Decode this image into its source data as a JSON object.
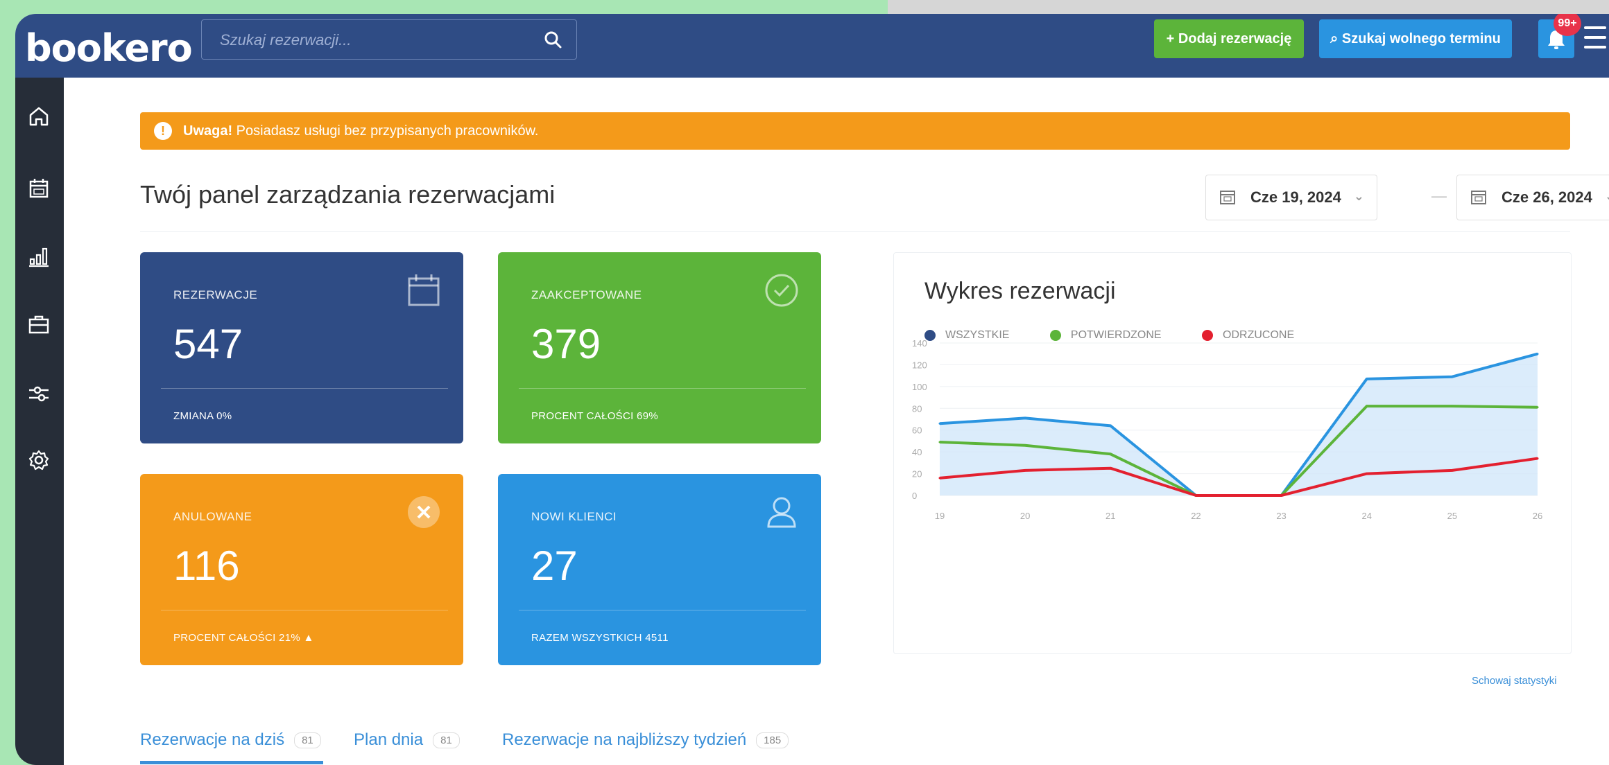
{
  "header": {
    "logo": "bookero",
    "search_placeholder": "Szukaj rezerwacji...",
    "add_button": "+ Dodaj rezerwację",
    "free_slot_button": "⌕ Szukaj wolnego terminu",
    "notifications_badge": "99+"
  },
  "sidebar": {
    "items": [
      "home-icon",
      "calendar-icon",
      "stats-icon",
      "briefcase-icon",
      "sliders-icon",
      "gear-icon"
    ]
  },
  "alert": {
    "bold": "Uwaga!",
    "text": " Posiadasz usługi bez przypisanych pracowników."
  },
  "page_title": "Twój panel zarządzania rezerwacjami",
  "date_range": {
    "from": "Cze 19, 2024",
    "to": "Cze 26, 2024",
    "separator": "—"
  },
  "cards": {
    "reservations": {
      "title": "REZERWACJE",
      "value": "547",
      "footer": "ZMIANA  0%",
      "color": "#2f4c85"
    },
    "accepted": {
      "title": "ZAAKCEPTOWANE",
      "value": "379",
      "footer": "PROCENT CAŁOŚCI  69%",
      "color": "#5cb43a"
    },
    "cancelled": {
      "title": "ANULOWANE",
      "value": "116",
      "footer": "PROCENT CAŁOŚCI  21%  ▲",
      "color": "#f49a1a"
    },
    "new_clients": {
      "title": "NOWI KLIENCI",
      "value": "27",
      "footer": "RAZEM WSZYSTKICH  4511",
      "color": "#2a94e0"
    }
  },
  "chart_data": {
    "type": "line",
    "title": "Wykres rezerwacji",
    "categories": [
      "19",
      "20",
      "21",
      "22",
      "23",
      "24",
      "25",
      "26"
    ],
    "ylim": [
      0,
      140
    ],
    "yticks": [
      "0",
      "20",
      "40",
      "60",
      "80",
      "100",
      "120",
      "140"
    ],
    "series": [
      {
        "name": "WSZYSTKIE",
        "color": "#2a94e0",
        "dot_color": "#2f4c85",
        "values": [
          66,
          71,
          64,
          0,
          0,
          107,
          109,
          130
        ]
      },
      {
        "name": "POTWIERDZONE",
        "color": "#5cb43a",
        "dot_color": "#5cb43a",
        "values": [
          49,
          46,
          38,
          0,
          0,
          82,
          82,
          81
        ]
      },
      {
        "name": "ODRZUCONE",
        "color": "#e3202f",
        "dot_color": "#e3202f",
        "values": [
          16,
          23,
          25,
          0,
          0,
          20,
          23,
          34
        ]
      }
    ],
    "grid": true,
    "legend_position": "top-left"
  },
  "hide_stats": "Schowaj statystyki",
  "tabs": [
    {
      "label": "Rezerwacje na dziś",
      "count": "81"
    },
    {
      "label": "Plan dnia",
      "count": "81"
    },
    {
      "label": "Rezerwacje na najbliższy tydzień",
      "count": "185"
    }
  ]
}
